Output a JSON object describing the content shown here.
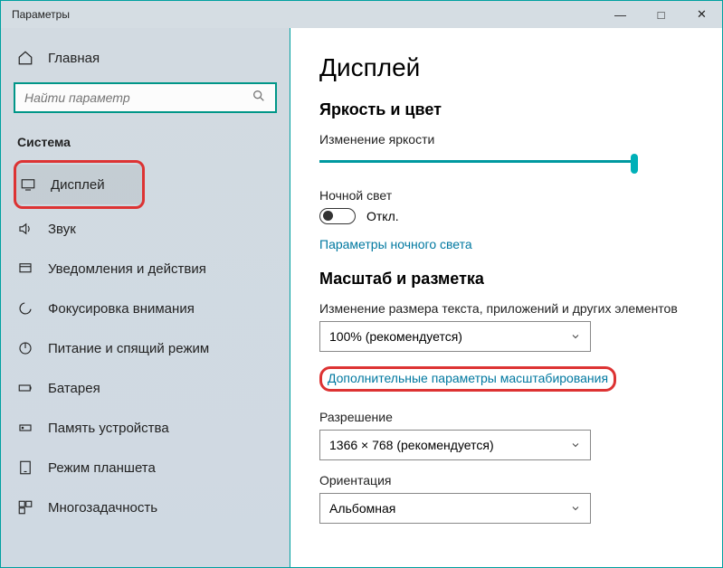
{
  "window": {
    "title": "Параметры"
  },
  "sidebar": {
    "home": "Главная",
    "search_placeholder": "Найти параметр",
    "category": "Система",
    "items": [
      {
        "label": "Дисплей"
      },
      {
        "label": "Звук"
      },
      {
        "label": "Уведомления и действия"
      },
      {
        "label": "Фокусировка внимания"
      },
      {
        "label": "Питание и спящий режим"
      },
      {
        "label": "Батарея"
      },
      {
        "label": "Память устройства"
      },
      {
        "label": "Режим планшета"
      },
      {
        "label": "Многозадачность"
      }
    ]
  },
  "page": {
    "title": "Дисплей",
    "brightness_section": "Яркость и цвет",
    "brightness_label": "Изменение яркости",
    "night_light_label": "Ночной свет",
    "night_light_value": "Откл.",
    "night_light_link": "Параметры ночного света",
    "scale_section": "Масштаб и разметка",
    "scale_label": "Изменение размера текста, приложений и других элементов",
    "scale_value": "100% (рекомендуется)",
    "advanced_scale_link": "Дополнительные параметры масштабирования",
    "resolution_label": "Разрешение",
    "resolution_value": "1366 × 768 (рекомендуется)",
    "orientation_label": "Ориентация",
    "orientation_value": "Альбомная"
  }
}
